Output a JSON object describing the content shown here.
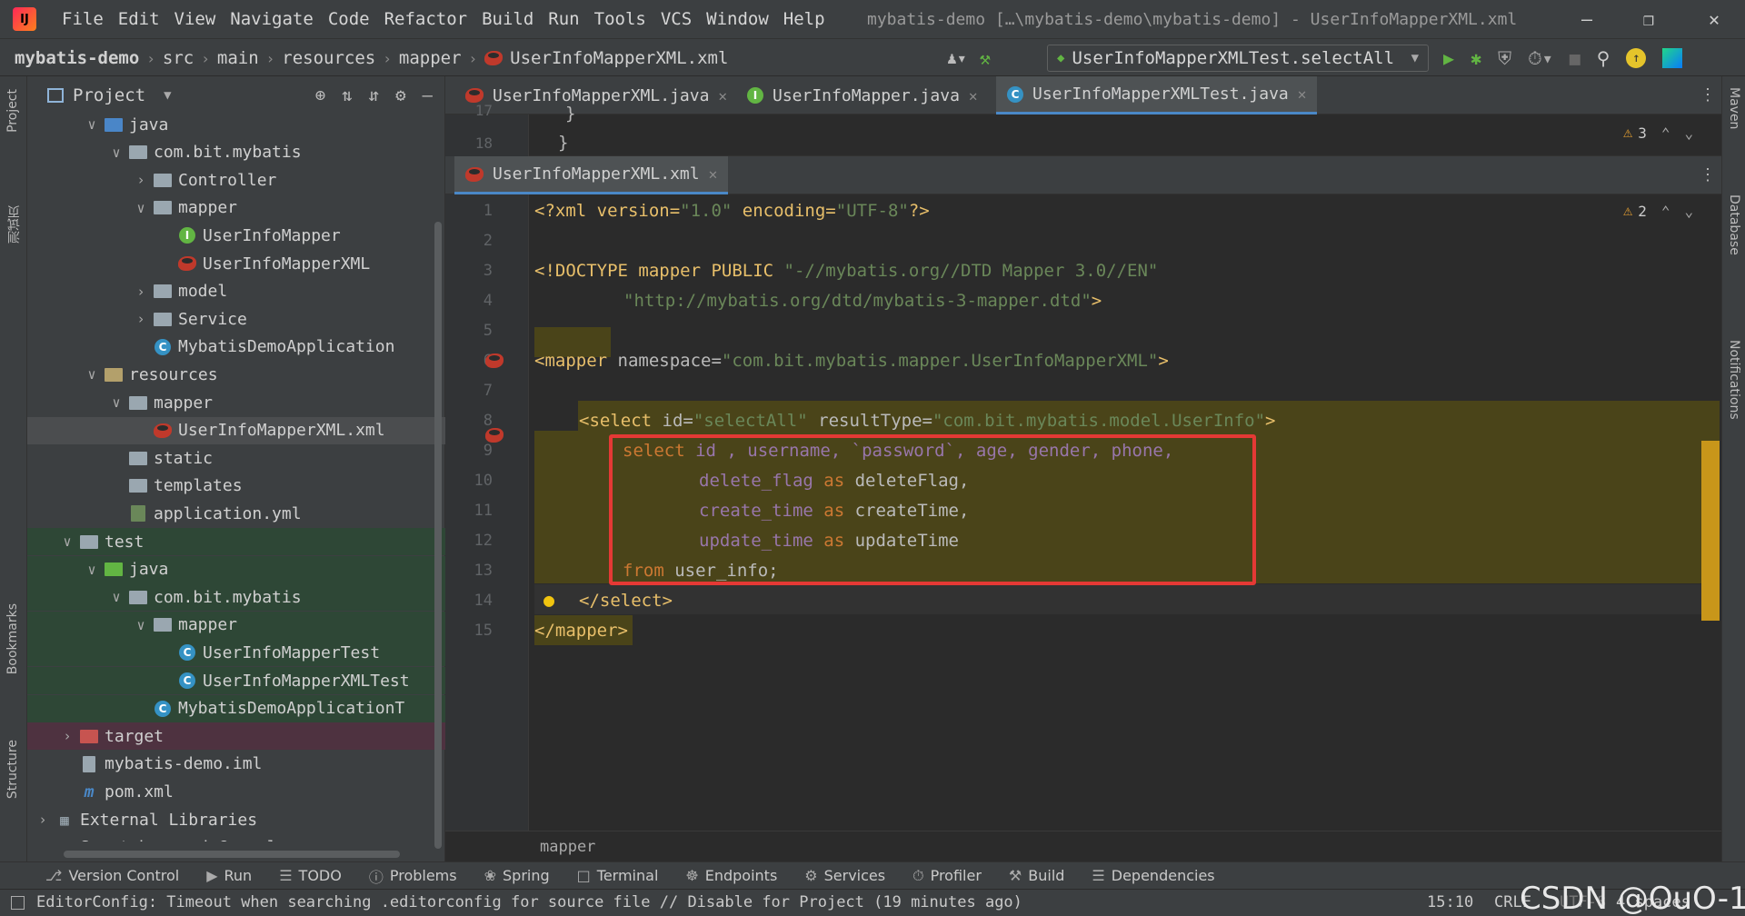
{
  "titlebar": {
    "menu": [
      "File",
      "Edit",
      "View",
      "Navigate",
      "Code",
      "Refactor",
      "Build",
      "Run",
      "Tools",
      "VCS",
      "Window",
      "Help"
    ],
    "title": "mybatis-demo […\\mybatis-demo\\mybatis-demo] - UserInfoMapperXML.xml"
  },
  "navbar": {
    "crumbs": [
      "mybatis-demo",
      "src",
      "main",
      "resources",
      "mapper",
      "UserInfoMapperXML.xml"
    ],
    "run_config": "UserInfoMapperXMLTest.selectAll"
  },
  "left_stripe": {
    "project": "Project",
    "cn": "测试页",
    "bookmarks": "Bookmarks",
    "structure": "Structure"
  },
  "right_stripe": {
    "maven": "Maven",
    "database": "Database",
    "notifications": "Notifications"
  },
  "project": {
    "header": "Project",
    "tree": [
      {
        "label": "java",
        "indent": 2,
        "arrow": "⌄",
        "icon": "folder-blue"
      },
      {
        "label": "com.bit.mybatis",
        "indent": 3,
        "arrow": "⌄",
        "icon": "folder"
      },
      {
        "label": "Controller",
        "indent": 4,
        "arrow": "›",
        "icon": "folder"
      },
      {
        "label": "mapper",
        "indent": 4,
        "arrow": "⌄",
        "icon": "folder"
      },
      {
        "label": "UserInfoMapper",
        "indent": 5,
        "arrow": "",
        "icon": "interface"
      },
      {
        "label": "UserInfoMapperXML",
        "indent": 5,
        "arrow": "",
        "icon": "mybatis"
      },
      {
        "label": "model",
        "indent": 4,
        "arrow": "›",
        "icon": "folder"
      },
      {
        "label": "Service",
        "indent": 4,
        "arrow": "›",
        "icon": "folder"
      },
      {
        "label": "MybatisDemoApplication",
        "indent": 4,
        "arrow": "",
        "icon": "class"
      },
      {
        "label": "resources",
        "indent": 2,
        "arrow": "⌄",
        "icon": "folder-res"
      },
      {
        "label": "mapper",
        "indent": 3,
        "arrow": "⌄",
        "icon": "folder"
      },
      {
        "label": "UserInfoMapperXML.xml",
        "indent": 4,
        "arrow": "",
        "icon": "mybatis",
        "selected": true
      },
      {
        "label": "static",
        "indent": 3,
        "arrow": "",
        "icon": "folder"
      },
      {
        "label": "templates",
        "indent": 3,
        "arrow": "",
        "icon": "folder"
      },
      {
        "label": "application.yml",
        "indent": 3,
        "arrow": "",
        "icon": "yml"
      },
      {
        "label": "test",
        "indent": 1,
        "arrow": "⌄",
        "icon": "folder",
        "test": true
      },
      {
        "label": "java",
        "indent": 2,
        "arrow": "⌄",
        "icon": "folder-green",
        "test": true
      },
      {
        "label": "com.bit.mybatis",
        "indent": 3,
        "arrow": "⌄",
        "icon": "folder",
        "test": true
      },
      {
        "label": "mapper",
        "indent": 4,
        "arrow": "⌄",
        "icon": "folder",
        "test": true
      },
      {
        "label": "UserInfoMapperTest",
        "indent": 5,
        "arrow": "",
        "icon": "class",
        "test": true
      },
      {
        "label": "UserInfoMapperXMLTest",
        "indent": 5,
        "arrow": "",
        "icon": "class",
        "test": true
      },
      {
        "label": "MybatisDemoApplicationT",
        "indent": 4,
        "arrow": "",
        "icon": "class",
        "test": true
      },
      {
        "label": "target",
        "indent": 1,
        "arrow": "›",
        "icon": "folder-red",
        "excluded": true
      },
      {
        "label": "mybatis-demo.iml",
        "indent": 1,
        "arrow": "",
        "icon": "iml"
      },
      {
        "label": "pom.xml",
        "indent": 1,
        "arrow": "",
        "icon": "maven"
      },
      {
        "label": "External Libraries",
        "indent": 0,
        "arrow": "›",
        "icon": "libs"
      },
      {
        "label": "Scratches and Consoles",
        "indent": 0,
        "arrow": "›",
        "icon": "scratch"
      }
    ]
  },
  "tabs_top": [
    {
      "label": "UserInfoMapperXML.java",
      "icon": "mybatis"
    },
    {
      "label": "UserInfoMapper.java",
      "icon": "interface"
    },
    {
      "label": "UserInfoMapperXMLTest.java",
      "icon": "class",
      "active": true
    }
  ],
  "mini_editor": {
    "line_17": "17",
    "line_18": "18",
    "brace_17": "}",
    "brace_18": "}",
    "warnings": "3"
  },
  "tabs_second": [
    {
      "label": "UserInfoMapperXML.xml",
      "icon": "mybatis",
      "active": true
    }
  ],
  "editor": {
    "warnings": "2",
    "breadcrumb": "mapper",
    "lines": [
      "1",
      "2",
      "3",
      "4",
      "5",
      "6",
      "7",
      "8",
      "9",
      "10",
      "11",
      "12",
      "13",
      "14",
      "15"
    ]
  },
  "code": {
    "l1a": "<?xml version=",
    "l1b": "\"1.0\"",
    "l1c": " encoding=",
    "l1d": "\"UTF-8\"",
    "l1e": "?>",
    "l3a": "<!DOCTYPE mapper PUBLIC ",
    "l3b": "\"-//mybatis.org//DTD Mapper 3.0//EN\"",
    "l4a": "\"http://mybatis.org/dtd/mybatis-3-mapper.dtd\"",
    "l4b": ">",
    "l6a": "<mapper",
    "l6b": " namespace=",
    "l6c": "\"com.bit.mybatis.mapper.UserInfoMapperXML\"",
    "l6d": ">",
    "l8a": "<select",
    "l8b": " id=",
    "l8c": "\"selectAll\"",
    "l8d": " resultType=",
    "l8e": "\"com.bit.mybatis.model.UserInfo\"",
    "l8f": ">",
    "l9a": "select",
    "l9b": " id , username, `password`, age, gender, phone,",
    "l10a": "delete_flag ",
    "l10b": "as",
    "l10c": " deleteFlag,",
    "l11a": "create_time ",
    "l11b": "as",
    "l11c": " createTime,",
    "l12a": "update_time ",
    "l12b": "as",
    "l12c": " updateTime",
    "l13a": "from",
    "l13b": " user_info;",
    "l14a": "</select>",
    "l15a": "</mapper>"
  },
  "toolwindows": [
    "Version Control",
    "Run",
    "TODO",
    "Problems",
    "Spring",
    "Terminal",
    "Endpoints",
    "Services",
    "Profiler",
    "Build",
    "Dependencies"
  ],
  "status": {
    "message": "EditorConfig: Timeout when searching .editorconfig for source file // Disable for Project (19 minutes ago)",
    "position": "15:10",
    "line_sep": "CRLF",
    "encoding": "UTF-8",
    "indent": "4 spaces",
    "watermark": "CSDN @OuO-1"
  },
  "colors": {
    "highlight": "#4a4419",
    "selection_box": "#e53935",
    "accent": "#4a88c7"
  }
}
